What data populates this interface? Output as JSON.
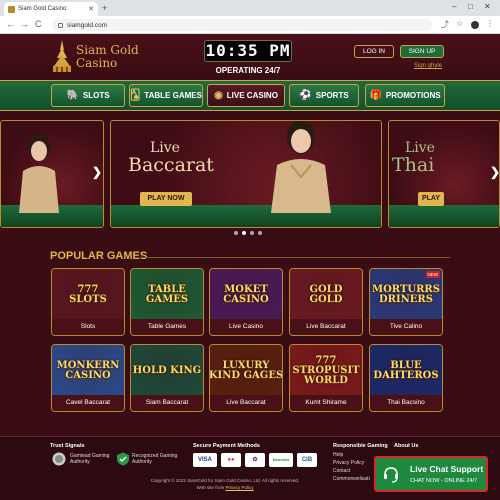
{
  "browser": {
    "tab_title": "Siam Gold Casino",
    "new_tab_glyph": "+",
    "url": "siamgold.com",
    "win_min": "–",
    "win_max": "□",
    "win_close": "✕",
    "tab_close": "✕",
    "back": "←",
    "forward": "→",
    "reload": "C",
    "share_icon": "⤴",
    "star_icon": "☆",
    "menu_icon": "⋮"
  },
  "header": {
    "brand_line1": "Siam Gold",
    "brand_line2": "Casino",
    "clock": "10:35 PM",
    "operating": "OPERATING 24/7",
    "login_label": "LOG IN",
    "signup_label": "SIGN UP",
    "signin_options": "Sign ghyle"
  },
  "nav": {
    "items": [
      {
        "label": "SLOTS",
        "icon": "elephant-icon",
        "glyph": "🐘"
      },
      {
        "label": "TABLE GAMES",
        "icon": "cards-icon",
        "glyph": "🂡"
      },
      {
        "label": "LIVE CASINO",
        "icon": "person-icon",
        "glyph": "◉"
      },
      {
        "label": "SPORTS",
        "icon": "ball-icon",
        "glyph": "⚽"
      },
      {
        "label": "PROMOTIONS",
        "icon": "gift-icon",
        "glyph": "🎁"
      }
    ]
  },
  "carousel": {
    "main_title_1": "Live",
    "main_title_2": "Baccarat",
    "main_play": "PLAY NOW",
    "right_title_1": "Live",
    "right_title_2": "Thai",
    "right_play": "PLAY",
    "prev_arrow": "❯",
    "next_arrow": "❯",
    "slide_count": 4,
    "active_slide": 1
  },
  "games": {
    "title": "POPULAR GAMES",
    "items": [
      {
        "art": "777\nSLOTS",
        "label": "Slots",
        "bg": "#5a1620"
      },
      {
        "art": "TABLE\nGAMES",
        "label": "Table Games",
        "bg": "#1d5a35"
      },
      {
        "art": "MOKET\nCASINO",
        "label": "Live Casino",
        "bg": "#4a1a58"
      },
      {
        "art": "GOLD\nGOLD",
        "label": "Live Baccarat",
        "bg": "#6a1a22"
      },
      {
        "art": "MORTURRS\nDRINERS",
        "label": "Tive Calino",
        "bg": "#2a3a7a",
        "badge": "NEW"
      },
      {
        "art": "MONKERN\nCASINO",
        "label": "Cavel Baccarat",
        "bg": "#2a4a8a"
      },
      {
        "art": "HOLD KING",
        "label": "Siam Baccarat",
        "bg": "#1d4a3a"
      },
      {
        "art": "LUXURY\nKIND GAGES",
        "label": "Live Baccarat",
        "bg": "#5a2010"
      },
      {
        "art": "777\nSTROPUSIT\nWORLD",
        "label": "Kumt Shirame",
        "bg": "#7a1a1a"
      },
      {
        "art": "BLUE\nDAHTEROS",
        "label": "Thai Bacsino",
        "bg": "#1a2a6a"
      }
    ]
  },
  "footer": {
    "trust_title": "Trust Signals",
    "trust_1": "Gamtead Gaming\nAuthority",
    "trust_2": "Recognized Gaming\nAuthority",
    "payment_title": "Secure Payment Methods",
    "payments": [
      "VISA",
      "●●",
      "✿",
      "Ncucisis",
      "CIB"
    ],
    "rg_title": "Responsible Gaming",
    "rg_links": [
      "Help",
      "Privacy Policy",
      "Contact",
      "Commonwelisati"
    ],
    "about_title": "About Us",
    "copyright": "Copyright © 2022 SiamGold for Siam Gold Casino, Ltd. All rights reserved.",
    "privacy_prefix": "Web site from ",
    "privacy_link": "Privacy Policy"
  },
  "chat": {
    "title": "Live Chat Support",
    "subtitle": "CHAT NOW - ONLINE 24/7"
  },
  "colors": {
    "gold": "#e0b64e",
    "maroon": "#3a0d14",
    "green": "#1f6b3a",
    "chat_border": "#d8262c"
  }
}
